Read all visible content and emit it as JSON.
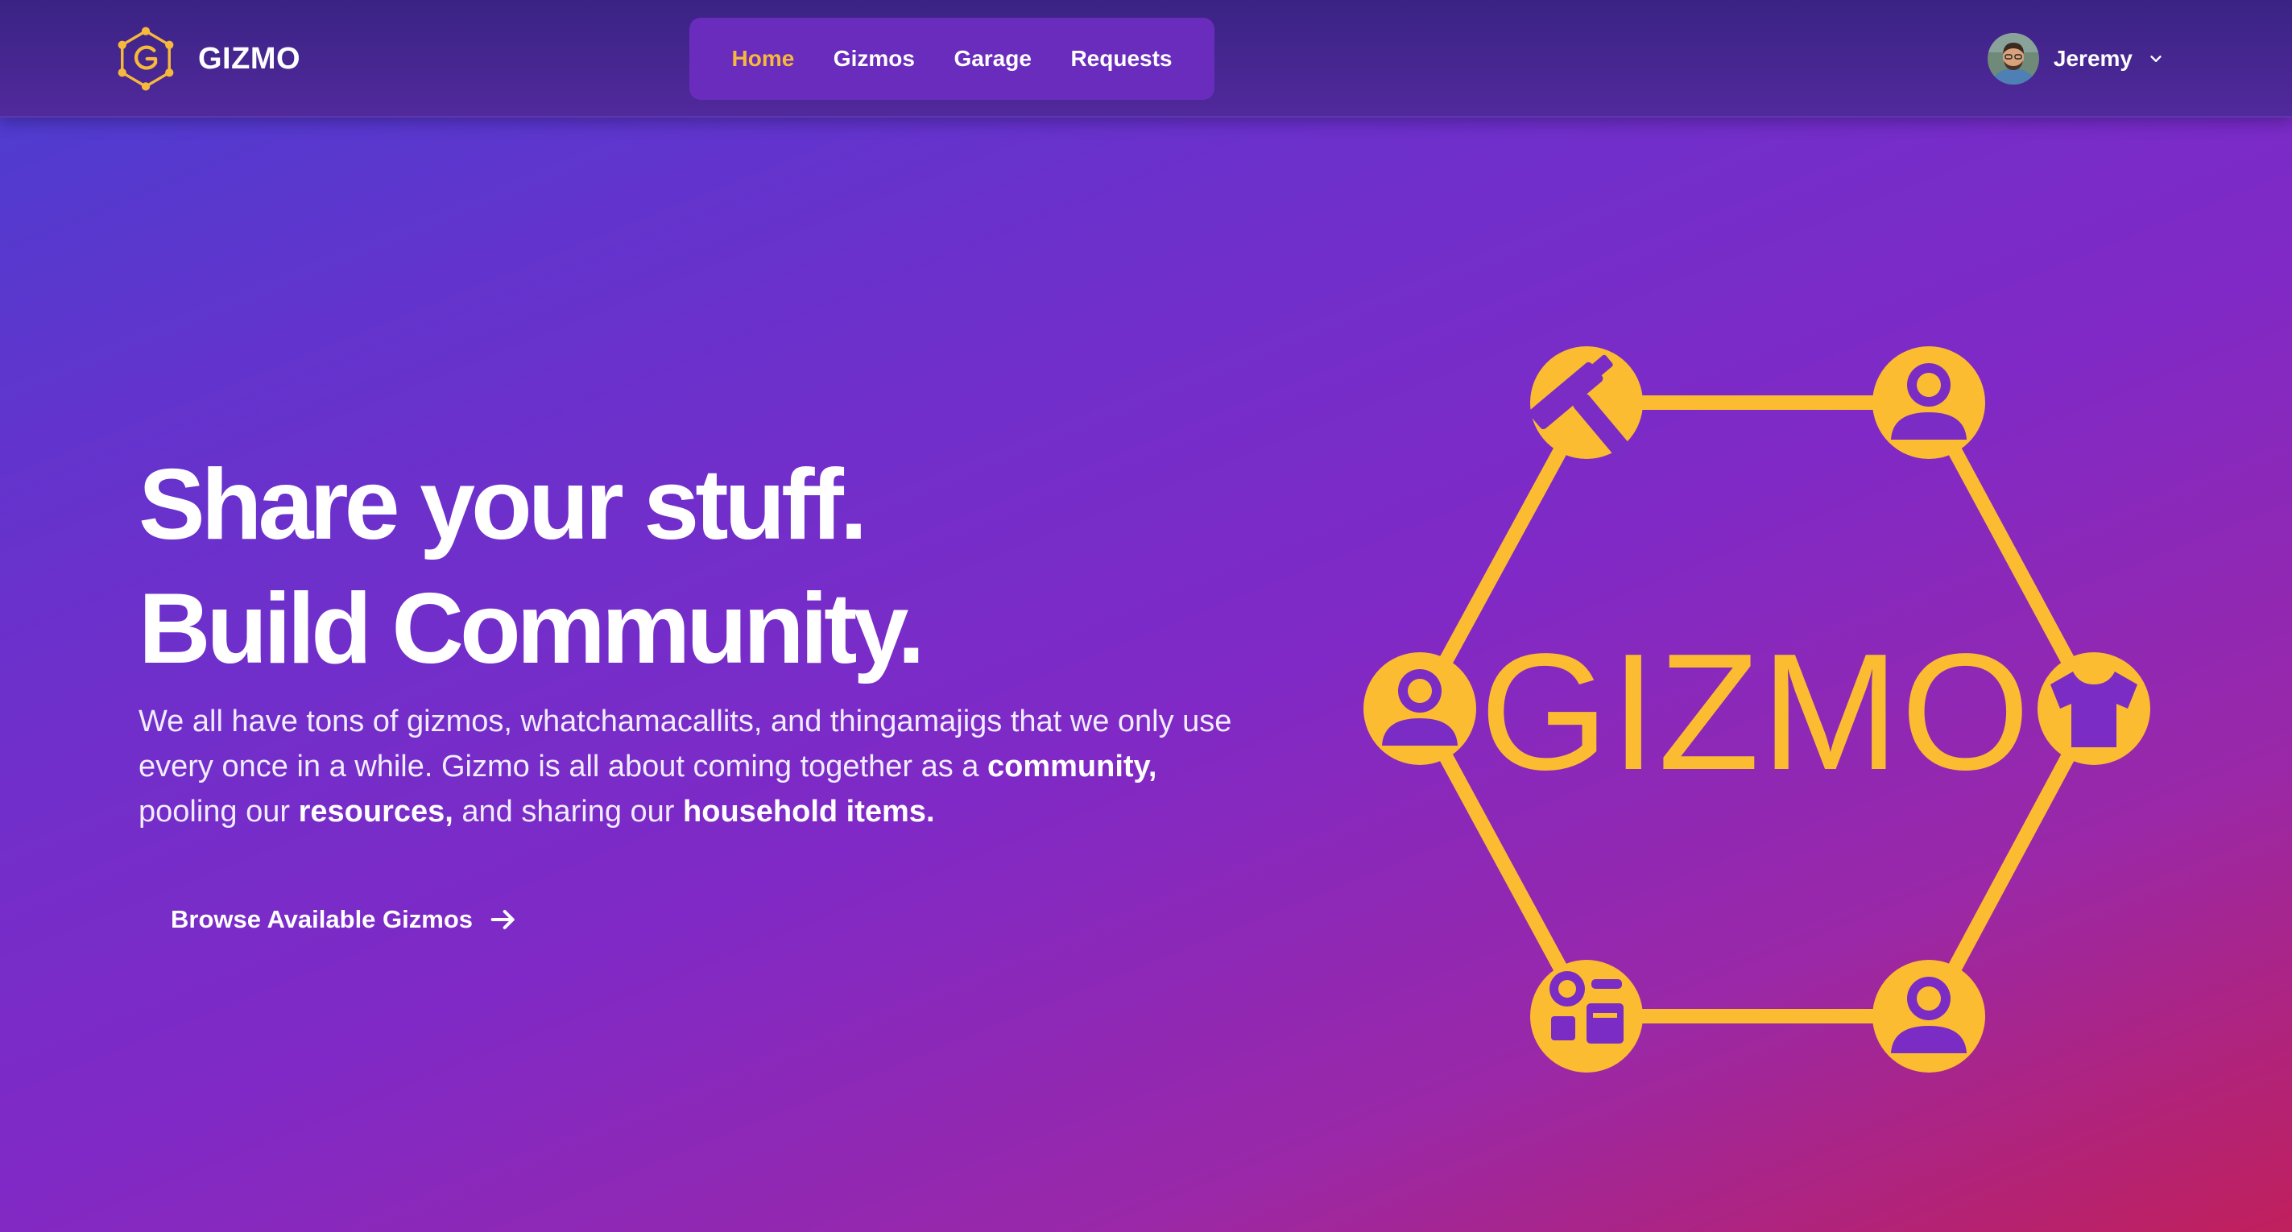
{
  "colors": {
    "accent": "#f6b93b",
    "logo_gold": "#fbbc31",
    "nav_background": "#6a2cbc",
    "hero_gradient_start": "#4a3ed0",
    "hero_gradient_end": "#c0205c"
  },
  "header": {
    "brand_name": "GIZMO",
    "brand_icon": "gizmo-hexagon-logo",
    "nav": [
      {
        "label": "Home",
        "active": true
      },
      {
        "label": "Gizmos",
        "active": false
      },
      {
        "label": "Garage",
        "active": false
      },
      {
        "label": "Requests",
        "active": false
      }
    ],
    "user": {
      "name": "Jeremy",
      "avatar": "user-avatar-photo",
      "menu_icon": "chevron-down-icon"
    }
  },
  "hero": {
    "title_line1": "Share your stuff.",
    "title_line2": "Build Community.",
    "description_parts": [
      "We all have tons of gizmos, whatchamacallits, and thingamajigs that we only use every once in a while. Gizmo is all about coming together as a ",
      "community,",
      " pooling our ",
      "resources,",
      " and sharing our ",
      "household items."
    ],
    "cta_label": "Browse Available Gizmos",
    "cta_icon": "arrow-right-icon"
  },
  "graphic": {
    "word": "GIZMO",
    "node_icons": [
      "hammer-icon",
      "user-icon",
      "user-icon",
      "tshirt-icon",
      "user-icon",
      "appliances-icon"
    ]
  }
}
